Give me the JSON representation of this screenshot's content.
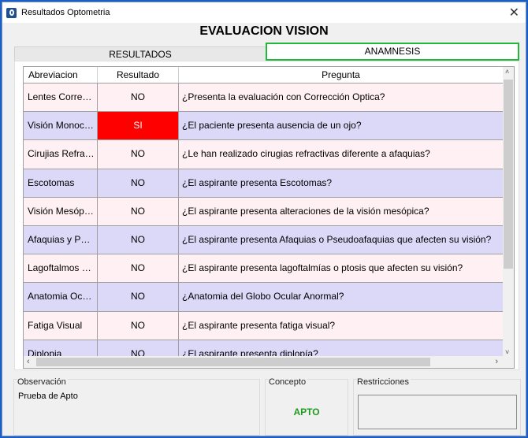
{
  "window": {
    "title": "Resultados Optometria",
    "close_icon": "close-icon"
  },
  "heading": "EVALUACION VISION",
  "tabs": [
    {
      "label": "RESULTADOS"
    },
    {
      "label": "ANAMNESIS",
      "selected": true
    }
  ],
  "table": {
    "columns": [
      "Abreviacion",
      "Resultado",
      "Pregunta"
    ],
    "rows": [
      {
        "abreviacion": "Lentes Corre…",
        "resultado": "NO",
        "pregunta": "¿Presenta la evaluación con Corrección Optica?"
      },
      {
        "abreviacion": "Visión Monoc…",
        "resultado": "SI",
        "pregunta": "¿El paciente presenta ausencia de un ojo?",
        "highlight": "#ff0000"
      },
      {
        "abreviacion": "Cirujias Refra…",
        "resultado": "NO",
        "pregunta": "¿Le han realizado cirugias refractivas diferente a afaquias?"
      },
      {
        "abreviacion": "Escotomas",
        "resultado": "NO",
        "pregunta": "¿El aspirante presenta Escotomas?"
      },
      {
        "abreviacion": "Visión Mesóp…",
        "resultado": "NO",
        "pregunta": "¿El aspirante presenta alteraciones de la visión mesópica?"
      },
      {
        "abreviacion": "Afaquias y P…",
        "resultado": "NO",
        "pregunta": "¿El aspirante presenta Afaquias o Pseudoafaquias que afecten su visión?"
      },
      {
        "abreviacion": "Lagoftalmos …",
        "resultado": "NO",
        "pregunta": "¿El aspirante presenta lagoftalmías o ptosis que afecten su visión?"
      },
      {
        "abreviacion": "Anatomia Oc…",
        "resultado": "NO",
        "pregunta": "¿Anatomia del Globo Ocular Anormal?"
      },
      {
        "abreviacion": "Fatiga Visual",
        "resultado": "NO",
        "pregunta": "¿El aspirante presenta fatiga visual?"
      },
      {
        "abreviacion": "Diplopia",
        "resultado": "NO",
        "pregunta": "¿El aspirante presenta diplopía?"
      }
    ],
    "row_colors": [
      "#fff0f4",
      "#dcd8f8"
    ]
  },
  "observacion": {
    "label": "Observación",
    "value": "Prueba de Apto"
  },
  "concepto": {
    "label": "Concepto",
    "value": "APTO",
    "color": "#1e9a1e"
  },
  "restricciones": {
    "label": "Restricciones",
    "value": ""
  }
}
